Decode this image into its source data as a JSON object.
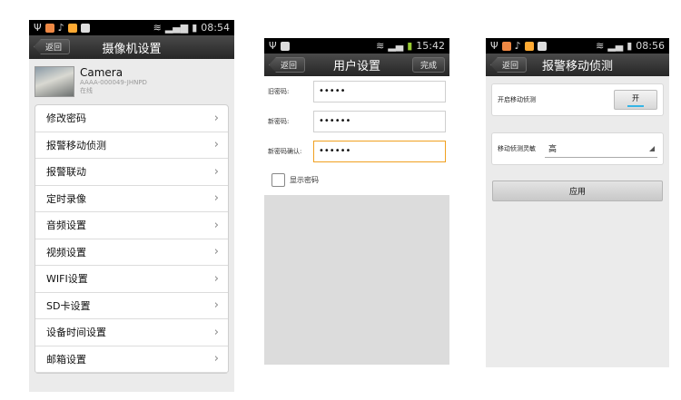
{
  "screen1": {
    "time": "08:54",
    "back_label": "返回",
    "title": "摄像机设置",
    "camera": {
      "name": "Camera",
      "id": "AAAA-000049-JHNPD",
      "status": "在线"
    },
    "menu": [
      "修改密码",
      "报警移动侦测",
      "报警联动",
      "定时录像",
      "音频设置",
      "视频设置",
      "WIFI设置",
      "SD卡设置",
      "设备时间设置",
      "邮箱设置"
    ]
  },
  "screen2": {
    "time": "15:42",
    "back_label": "返回",
    "title": "用户设置",
    "done_label": "完成",
    "fields": [
      {
        "label": "旧密码:",
        "value": "•••••"
      },
      {
        "label": "新密码:",
        "value": "••••••"
      },
      {
        "label": "新密码确认:",
        "value": "••••••"
      }
    ],
    "show_password_label": "显示密码"
  },
  "screen3": {
    "time": "08:56",
    "back_label": "返回",
    "title": "报警移动侦测",
    "motion_label": "开启移动侦测",
    "motion_toggle": "开",
    "sensitivity_label": "移动侦测灵敏",
    "sensitivity_value": "高",
    "apply_label": "应用"
  },
  "colors": {
    "focus": "#f0a020",
    "toggle_accent": "#35b5e5"
  }
}
